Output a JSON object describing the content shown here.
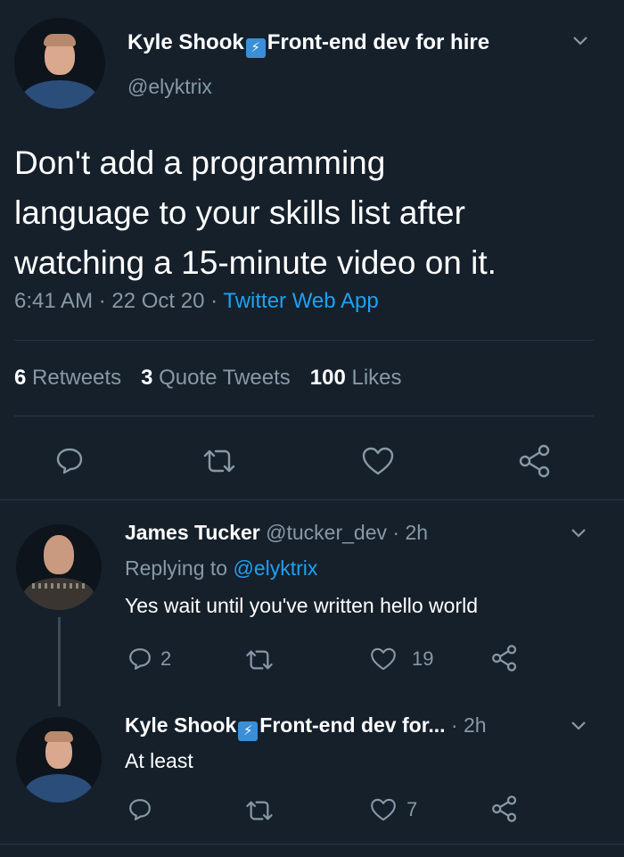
{
  "main_tweet": {
    "author_name": "Kyle Shook",
    "author_bio": "Front-end dev for hire",
    "author_handle": "@elyktrix",
    "text_line1": "Don't add a programming",
    "text_line2": "language to your skills list after",
    "text_line3": "watching a 15-minute video on it.",
    "time": "6:41 AM",
    "date": "22 Oct 20",
    "source": "Twitter Web App",
    "retweets_count": "6",
    "retweets_label": "Retweets",
    "quotes_count": "3",
    "quotes_label": "Quote Tweets",
    "likes_count": "100",
    "likes_label": "Likes"
  },
  "reply1": {
    "author_name": "James Tucker",
    "author_handle": "@tucker_dev",
    "time": "2h",
    "replying_label": "Replying to",
    "replying_handle": "@elyktrix",
    "text": "Yes wait until you've written hello world",
    "reply_count": "2",
    "like_count": "19"
  },
  "reply2": {
    "author_name": "Kyle Shook",
    "author_bio": "Front-end dev for...",
    "time": "2h",
    "text": "At least",
    "like_count": "7"
  },
  "icons": {
    "reply": "speech-bubble-icon",
    "retweet": "retweet-arrows-icon",
    "like": "heart-outline-icon",
    "share": "share-nodes-icon",
    "caret": "chevron-down-icon"
  },
  "colors": {
    "background": "#15202b",
    "link": "#1da1f2",
    "muted": "#8899a6",
    "verified_badge": "#3a8fd6"
  }
}
